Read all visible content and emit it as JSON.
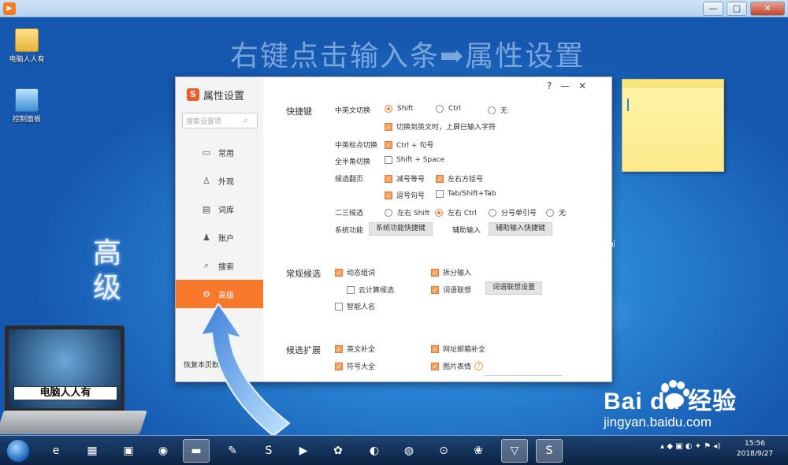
{
  "outer_window": {
    "title": "",
    "controls": {
      "minimize": "—",
      "maximize": "▢",
      "close": "✕"
    }
  },
  "desktop": {
    "icons": [
      {
        "label": "电脑人人有"
      },
      {
        "label": "控制面板"
      }
    ],
    "tutorial_heading": "右键点击输入条➡属性设置",
    "side_label": "高级",
    "laptop_banner": "电脑人人有"
  },
  "dialog": {
    "title": "属性设置",
    "brand_logo": "S",
    "help": "?",
    "minimize": "—",
    "close": "✕",
    "search_placeholder": "搜索设置项",
    "nav": [
      {
        "icon": "monitor-icon",
        "label": "常用"
      },
      {
        "icon": "shirt-icon",
        "label": "外观"
      },
      {
        "icon": "book-icon",
        "label": "词库"
      },
      {
        "icon": "user-icon",
        "label": "账户"
      },
      {
        "icon": "search-icon",
        "label": "搜索"
      },
      {
        "icon": "gear-icon",
        "label": "高级",
        "active": true
      }
    ],
    "restore_label": "恢复本页默认",
    "sections": {
      "hotkeys": {
        "title": "快捷键",
        "cn_en_switch": {
          "label": "中英文切换",
          "options": [
            "Shift",
            "Ctrl",
            "无"
          ],
          "selected": "Shift",
          "commit_on_switch": {
            "label": "切换到英文时，上屏已输入字符",
            "checked": true
          }
        },
        "punct_switch": {
          "label": "中英标点切换",
          "option": "Ctrl + 句号",
          "checked": true
        },
        "full_half": {
          "label": "全半角切换",
          "option": "Shift + Space",
          "checked": false
        },
        "page_turn": {
          "label": "候选翻页",
          "options": [
            {
              "label": "减号等号",
              "checked": true
            },
            {
              "label": "左右方括号",
              "checked": true
            },
            {
              "label": "逗号句号",
              "checked": true
            },
            {
              "label": "Tab/Shift+Tab",
              "checked": false
            }
          ]
        },
        "second_third": {
          "label": "二三候选",
          "options": [
            "左右 Shift",
            "左右 Ctrl",
            "分号单引号",
            "无"
          ],
          "selected": "左右 Ctrl"
        },
        "system_func": {
          "label": "系统功能",
          "button": "系统功能快捷键"
        },
        "aux_input": {
          "label": "辅助输入",
          "button": "辅助输入快捷键"
        }
      },
      "candidates": {
        "title": "常规候选",
        "items": [
          {
            "label": "动态组词",
            "checked": true
          },
          {
            "label": "拆分输入",
            "checked": true
          },
          {
            "label": "云计算候选",
            "checked": false
          },
          {
            "label": "词语联想",
            "checked": true
          },
          {
            "label": "智能人名",
            "checked": false
          }
        ],
        "assoc_button": "词语联想设置"
      },
      "extension": {
        "title": "候选扩展",
        "items": [
          {
            "label": "英文补全",
            "checked": true
          },
          {
            "label": "网址邮箱补全",
            "checked": true
          },
          {
            "label": "符号大全",
            "checked": true
          },
          {
            "label": "图片表情",
            "checked": true
          }
        ]
      }
    }
  },
  "watermark": {
    "brand": "Bai du 经验",
    "url": "jingyan.baidu.com"
  },
  "taskbar": {
    "items": [
      "ie-icon",
      "explorer-icon",
      "media-icon",
      "chrome-icon",
      "folder-icon",
      "paint-icon",
      "sogou-icon",
      "player-icon",
      "colors-icon",
      "chat-icon",
      "chess-icon",
      "settings-icon",
      "flower-icon",
      "shield-icon",
      "sogou-input-icon"
    ],
    "clock_time": "15:56",
    "clock_date": "2018/9/27"
  }
}
